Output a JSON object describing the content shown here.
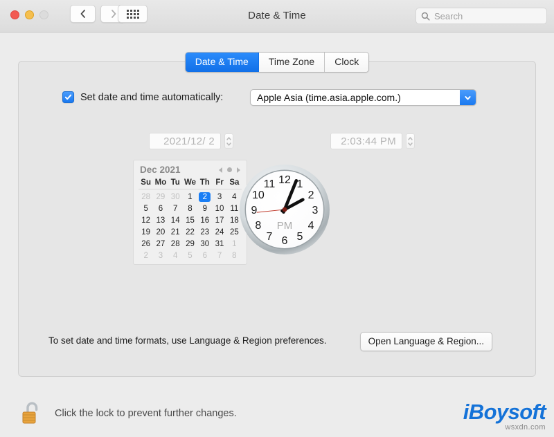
{
  "window": {
    "title": "Date & Time",
    "traffic_lights": [
      "close",
      "minimize",
      "zoom"
    ],
    "back_icon": "chevron-left-icon",
    "forward_icon": "chevron-right-icon",
    "grid_icon": "grid-dots-icon"
  },
  "search": {
    "placeholder": "Search",
    "icon": "search-icon",
    "value": ""
  },
  "tabs": [
    {
      "label": "Date & Time",
      "active": true
    },
    {
      "label": "Time Zone",
      "active": false
    },
    {
      "label": "Clock",
      "active": false
    }
  ],
  "auto": {
    "checkbox_checked": true,
    "checkbox_icon": "checkmark-icon",
    "label": "Set date and time automatically:",
    "server_value": "Apple Asia (time.asia.apple.com.)",
    "dropdown_icon": "chevron-down-icon",
    "accent_color": "#1a79f0"
  },
  "date_field": {
    "value": "2021/12/ 2",
    "enabled": false,
    "stepper_icon": "stepper-up-down-icon"
  },
  "time_field": {
    "value": "2:03:44 PM",
    "enabled": false,
    "stepper_icon": "stepper-up-down-icon"
  },
  "calendar": {
    "month_label": "Dec 2021",
    "prev_icon": "triangle-left-icon",
    "today_icon": "dot-icon",
    "next_icon": "triangle-right-icon",
    "weekdays": [
      "Su",
      "Mo",
      "Tu",
      "We",
      "Th",
      "Fr",
      "Sa"
    ],
    "selected_day": 2,
    "selected_color": "#1a7ef5",
    "weeks": [
      [
        {
          "d": "28",
          "dim": true
        },
        {
          "d": "29",
          "dim": true
        },
        {
          "d": "30",
          "dim": true
        },
        {
          "d": "1",
          "dim": false
        },
        {
          "d": "2",
          "dim": false,
          "sel": true
        },
        {
          "d": "3",
          "dim": false
        },
        {
          "d": "4",
          "dim": false
        }
      ],
      [
        {
          "d": "5",
          "dim": false
        },
        {
          "d": "6",
          "dim": false
        },
        {
          "d": "7",
          "dim": false
        },
        {
          "d": "8",
          "dim": false
        },
        {
          "d": "9",
          "dim": false
        },
        {
          "d": "10",
          "dim": false
        },
        {
          "d": "11",
          "dim": false
        }
      ],
      [
        {
          "d": "12",
          "dim": false
        },
        {
          "d": "13",
          "dim": false
        },
        {
          "d": "14",
          "dim": false
        },
        {
          "d": "15",
          "dim": false
        },
        {
          "d": "16",
          "dim": false
        },
        {
          "d": "17",
          "dim": false
        },
        {
          "d": "18",
          "dim": false
        }
      ],
      [
        {
          "d": "19",
          "dim": false
        },
        {
          "d": "20",
          "dim": false
        },
        {
          "d": "21",
          "dim": false
        },
        {
          "d": "22",
          "dim": false
        },
        {
          "d": "23",
          "dim": false
        },
        {
          "d": "24",
          "dim": false
        },
        {
          "d": "25",
          "dim": false
        }
      ],
      [
        {
          "d": "26",
          "dim": false
        },
        {
          "d": "27",
          "dim": false
        },
        {
          "d": "28",
          "dim": false
        },
        {
          "d": "29",
          "dim": false
        },
        {
          "d": "30",
          "dim": false
        },
        {
          "d": "31",
          "dim": false
        },
        {
          "d": "1",
          "dim": true
        }
      ],
      [
        {
          "d": "2",
          "dim": true
        },
        {
          "d": "3",
          "dim": true
        },
        {
          "d": "4",
          "dim": true
        },
        {
          "d": "5",
          "dim": true
        },
        {
          "d": "6",
          "dim": true
        },
        {
          "d": "7",
          "dim": true
        },
        {
          "d": "8",
          "dim": true
        }
      ]
    ]
  },
  "clock": {
    "meridiem_label": "PM",
    "hours": [
      "12",
      "1",
      "2",
      "3",
      "4",
      "5",
      "6",
      "7",
      "8",
      "9",
      "10",
      "11"
    ],
    "hour_angle": 61.5,
    "minute_angle": 22,
    "second_angle": 264,
    "second_hand_color": "#c0392b"
  },
  "footer": {
    "format_note": "To set date and time formats, use Language & Region preferences.",
    "open_button": "Open Language & Region..."
  },
  "lock": {
    "icon": "unlocked-padlock-icon",
    "text": "Click the lock to prevent further changes."
  },
  "watermark": {
    "logo": "iBoysoft",
    "sub": "wsxdn.com",
    "color": "#1472d8"
  }
}
